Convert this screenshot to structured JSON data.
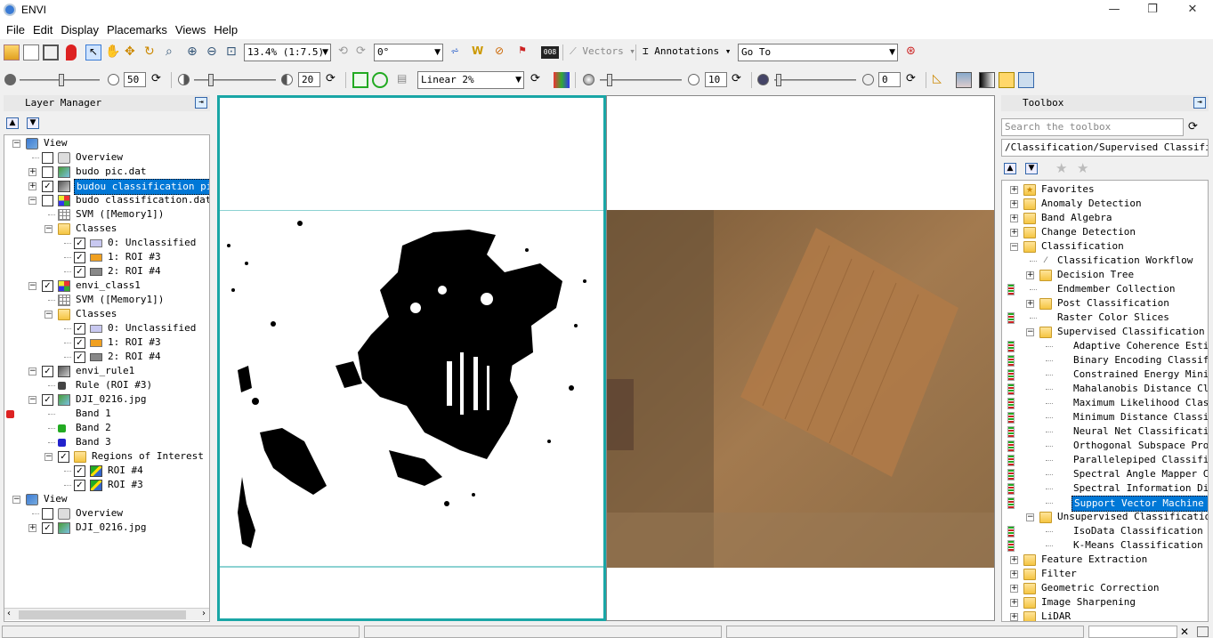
{
  "window": {
    "title": "ENVI"
  },
  "menu": [
    "File",
    "Edit",
    "Display",
    "Placemarks",
    "Views",
    "Help"
  ],
  "toolbar1": {
    "zoom_value": "13.4% (1:7.5)",
    "rotation_value": "0°",
    "vectors_label": "Vectors",
    "annotations_label": "Annotations",
    "goto_value": "Go To"
  },
  "toolbar2": {
    "brightness_value": "50",
    "contrast_value": "20",
    "stretch_value": "Linear 2%",
    "sharpen_value": "10",
    "transparency_value": "0"
  },
  "layer_manager": {
    "title": "Layer Manager",
    "rows": [
      {
        "label": "View",
        "depth": 0,
        "icon": "view-icon",
        "expander": "-",
        "check": null
      },
      {
        "label": "Overview",
        "depth": 1,
        "icon": "overview-icon",
        "expander": null,
        "check": "off"
      },
      {
        "label": "budo pic.dat",
        "depth": 1,
        "icon": "raster-icon",
        "expander": "+",
        "check": "off"
      },
      {
        "label": "budou classification pic.",
        "depth": 1,
        "icon": "gray-raster-icon",
        "expander": "+",
        "check": "on",
        "selected": true
      },
      {
        "label": "budo classification.dat",
        "depth": 1,
        "icon": "classification-icon",
        "expander": "-",
        "check": "off"
      },
      {
        "label": "SVM ([Memory1])",
        "depth": 2,
        "icon": "grid-icon",
        "expander": null,
        "check": null
      },
      {
        "label": "Classes",
        "depth": 2,
        "icon": "folder-icon",
        "expander": "-",
        "check": null
      },
      {
        "label": "0: Unclassified",
        "depth": 3,
        "icon": "swatch-lavender",
        "expander": null,
        "check": "on"
      },
      {
        "label": "1: ROI #3",
        "depth": 3,
        "icon": "swatch-orange",
        "expander": null,
        "check": "on"
      },
      {
        "label": "2: ROI #4",
        "depth": 3,
        "icon": "swatch-gray",
        "expander": null,
        "check": "on"
      },
      {
        "label": "envi_class1",
        "depth": 1,
        "icon": "classification-icon",
        "expander": "-",
        "check": "on"
      },
      {
        "label": "SVM ([Memory1])",
        "depth": 2,
        "icon": "grid-icon",
        "expander": null,
        "check": null
      },
      {
        "label": "Classes",
        "depth": 2,
        "icon": "folder-icon",
        "expander": "-",
        "check": null
      },
      {
        "label": "0: Unclassified",
        "depth": 3,
        "icon": "swatch-lavender",
        "expander": null,
        "check": "on"
      },
      {
        "label": "1: ROI #3",
        "depth": 3,
        "icon": "swatch-orange",
        "expander": null,
        "check": "on"
      },
      {
        "label": "2: ROI #4",
        "depth": 3,
        "icon": "swatch-gray",
        "expander": null,
        "check": "on"
      },
      {
        "label": "envi_rule1",
        "depth": 1,
        "icon": "gray-raster-icon",
        "expander": "-",
        "check": "on"
      },
      {
        "label": "Rule (ROI #3)",
        "depth": 2,
        "icon": "band-gray-icon",
        "expander": null,
        "check": null
      },
      {
        "label": "DJI_0216.jpg",
        "depth": 1,
        "icon": "raster-icon",
        "expander": "-",
        "check": "on"
      },
      {
        "label": "Band 1",
        "depth": 2,
        "icon": "band-red-icon",
        "expander": null,
        "check": null
      },
      {
        "label": "Band 2",
        "depth": 2,
        "icon": "band-green-icon",
        "expander": null,
        "check": null
      },
      {
        "label": "Band 3",
        "depth": 2,
        "icon": "band-blue-icon",
        "expander": null,
        "check": null
      },
      {
        "label": "Regions of Interest",
        "depth": 2,
        "icon": "folder-icon",
        "expander": "-",
        "check": "on"
      },
      {
        "label": "ROI #4",
        "depth": 3,
        "icon": "roi-icon",
        "expander": null,
        "check": "on"
      },
      {
        "label": "ROI #3",
        "depth": 3,
        "icon": "roi-icon",
        "expander": null,
        "check": "on"
      },
      {
        "label": "View",
        "depth": 0,
        "icon": "view-icon",
        "expander": "-",
        "check": null
      },
      {
        "label": "Overview",
        "depth": 1,
        "icon": "overview-icon",
        "expander": null,
        "check": "off"
      },
      {
        "label": "DJI_0216.jpg",
        "depth": 1,
        "icon": "raster-icon",
        "expander": "+",
        "check": "on"
      }
    ]
  },
  "toolbox": {
    "title": "Toolbox",
    "search_placeholder": "Search the toolbox",
    "path": "/Classification/Supervised Classificat",
    "rows": [
      {
        "label": "Favorites",
        "depth": 0,
        "icon": "favorites-folder-icon",
        "expander": "+"
      },
      {
        "label": "Anomaly Detection",
        "depth": 0,
        "icon": "folder-icon",
        "expander": "+"
      },
      {
        "label": "Band Algebra",
        "depth": 0,
        "icon": "folder-icon",
        "expander": "+"
      },
      {
        "label": "Change Detection",
        "depth": 0,
        "icon": "folder-icon",
        "expander": "+"
      },
      {
        "label": "Classification",
        "depth": 0,
        "icon": "folder-icon",
        "expander": "-"
      },
      {
        "label": "Classification Workflow",
        "depth": 1,
        "icon": "wand-icon",
        "expander": null
      },
      {
        "label": "Decision Tree",
        "depth": 1,
        "icon": "folder-icon",
        "expander": "+"
      },
      {
        "label": "Endmember Collection",
        "depth": 1,
        "icon": "tool-icon",
        "expander": null
      },
      {
        "label": "Post Classification",
        "depth": 1,
        "icon": "folder-icon",
        "expander": "+"
      },
      {
        "label": "Raster Color Slices",
        "depth": 1,
        "icon": "tool-icon",
        "expander": null
      },
      {
        "label": "Supervised Classification",
        "depth": 1,
        "icon": "folder-icon",
        "expander": "-"
      },
      {
        "label": "Adaptive Coherence Estima",
        "depth": 2,
        "icon": "tool-icon",
        "expander": null
      },
      {
        "label": "Binary Encoding Classific",
        "depth": 2,
        "icon": "tool-icon",
        "expander": null
      },
      {
        "label": "Constrained Energy Minimi",
        "depth": 2,
        "icon": "tool-icon",
        "expander": null
      },
      {
        "label": "Mahalanobis Distance Clas",
        "depth": 2,
        "icon": "tool-icon",
        "expander": null
      },
      {
        "label": "Maximum Likelihood Classi",
        "depth": 2,
        "icon": "tool-icon",
        "expander": null
      },
      {
        "label": "Minimum Distance Classifi",
        "depth": 2,
        "icon": "tool-icon",
        "expander": null
      },
      {
        "label": "Neural Net Classification",
        "depth": 2,
        "icon": "tool-icon",
        "expander": null
      },
      {
        "label": "Orthogonal Subspace Proje",
        "depth": 2,
        "icon": "tool-icon",
        "expander": null
      },
      {
        "label": "Parallelepiped Classifica",
        "depth": 2,
        "icon": "tool-icon",
        "expander": null
      },
      {
        "label": "Spectral Angle Mapper Cla",
        "depth": 2,
        "icon": "tool-icon",
        "expander": null
      },
      {
        "label": "Spectral Information Dive",
        "depth": 2,
        "icon": "tool-icon",
        "expander": null
      },
      {
        "label": "Support Vector Machine Cl",
        "depth": 2,
        "icon": "tool-icon",
        "expander": null,
        "selected": true
      },
      {
        "label": "Unsupervised Classification",
        "depth": 1,
        "icon": "folder-icon",
        "expander": "-"
      },
      {
        "label": "IsoData Classification",
        "depth": 2,
        "icon": "tool-icon",
        "expander": null
      },
      {
        "label": "K-Means Classification",
        "depth": 2,
        "icon": "tool-icon",
        "expander": null
      },
      {
        "label": "Feature Extraction",
        "depth": 0,
        "icon": "folder-icon",
        "expander": "+"
      },
      {
        "label": "Filter",
        "depth": 0,
        "icon": "folder-icon",
        "expander": "+"
      },
      {
        "label": "Geometric Correction",
        "depth": 0,
        "icon": "folder-icon",
        "expander": "+"
      },
      {
        "label": "Image Sharpening",
        "depth": 0,
        "icon": "folder-icon",
        "expander": "+"
      },
      {
        "label": "LiDAR",
        "depth": 0,
        "icon": "folder-icon",
        "expander": "+"
      }
    ]
  },
  "colors": {
    "selection": "#0078d7",
    "active_view_border": "#1aa6a6",
    "swatch_lavender": "#c8c8f0",
    "swatch_orange": "#f0a020",
    "swatch_gray": "#888888"
  }
}
